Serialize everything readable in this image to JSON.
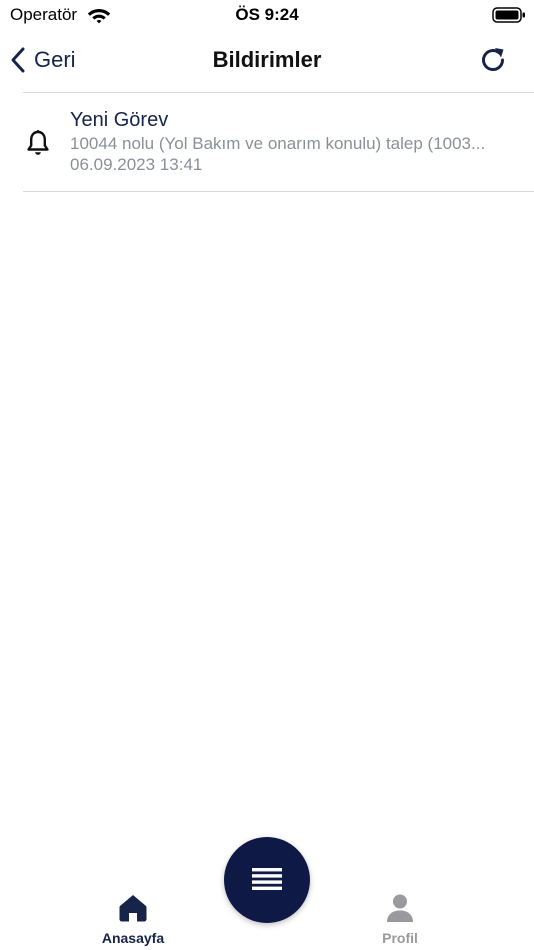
{
  "status_bar": {
    "carrier": "Operatör",
    "time": "ÖS 9:24"
  },
  "nav": {
    "back_label": "Geri",
    "title": "Bildirimler"
  },
  "notifications": [
    {
      "title": "Yeni Görev",
      "message": "10044 nolu (Yol Bakım ve onarım  konulu) talep (1003...",
      "date": "06.09.2023 13:41"
    }
  ],
  "tab_bar": {
    "home_label": "Anasayfa",
    "profile_label": "Profil"
  },
  "colors": {
    "brand": "#16244a",
    "fab": "#0e1a45",
    "secondary_text": "#8b8f99",
    "inactive": "#9a9a9e"
  },
  "icons": {
    "wifi": "wifi-icon",
    "battery": "battery-icon",
    "back": "chevron-left-icon",
    "refresh": "refresh-icon",
    "notification": "bell-icon",
    "menu": "menu-icon",
    "home": "home-icon",
    "profile": "user-icon"
  }
}
